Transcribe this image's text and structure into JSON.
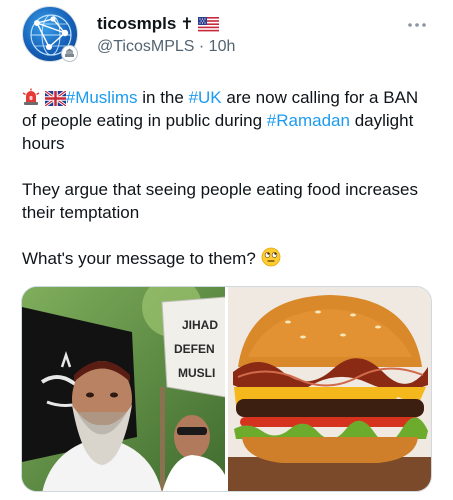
{
  "author": {
    "display_name": "ticosmpls",
    "name_suffix_glyph": "✝",
    "flag": "us-flag-icon",
    "handle": "@TicosMPLS",
    "separator": " · ",
    "time": "10h"
  },
  "tweet": {
    "line1": {
      "pre_emoji": "rotating-light-icon",
      "flag": "uk-flag-icon",
      "tag_muslims": "#Muslims",
      "text_a": " in the ",
      "tag_uk": "#UK",
      "text_b": " are now calling for a BAN of people eating in public during ",
      "tag_ramadan": "#Ramadan",
      "text_c": " daylight hours"
    },
    "line2": "They argue that seeing people eating food increases their temptation",
    "line3": "What's your message to them? ",
    "line3_emoji": "rolling-eyes-icon"
  },
  "media": {
    "left_sign_lines": [
      "JIHAD",
      "DEFEN",
      "MUSLI"
    ]
  },
  "colors": {
    "hashtag": "#1d9bf0",
    "secondary_text": "#536471"
  }
}
